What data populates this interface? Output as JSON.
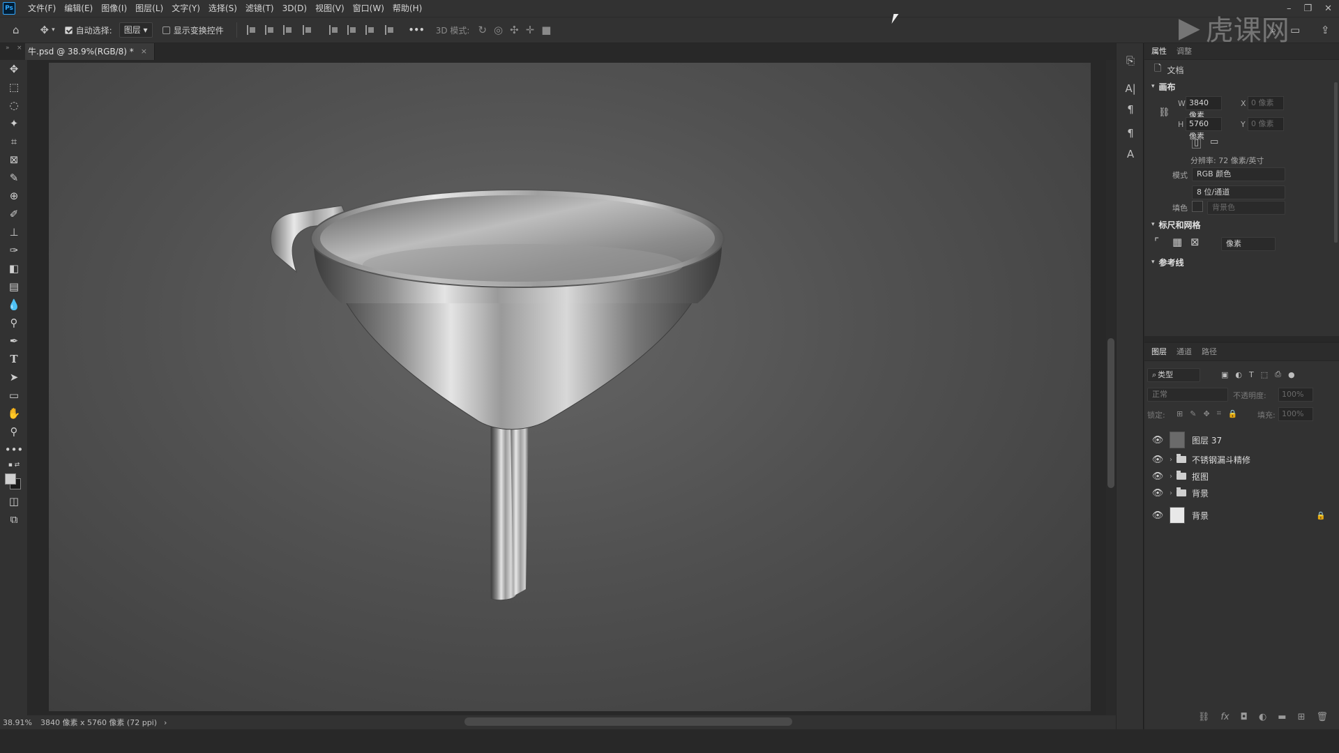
{
  "app": {
    "logo": "Ps"
  },
  "menu": [
    "文件(F)",
    "编辑(E)",
    "图像(I)",
    "图层(L)",
    "文字(Y)",
    "选择(S)",
    "滤镜(T)",
    "3D(D)",
    "视图(V)",
    "窗口(W)",
    "帮助(H)"
  ],
  "options": {
    "auto_select_label": "自动选择:",
    "auto_select_value": "图层",
    "show_transform_label": "显示变换控件",
    "mode_3d_label": "3D 模式:",
    "more": "•••"
  },
  "document": {
    "tab_title": "牛.psd @ 38.9%(RGB/8) *",
    "close": "×"
  },
  "status": {
    "zoom": "38.91%",
    "info": "3840 像素 x 5760 像素 (72 ppi)",
    "arrow": "›"
  },
  "properties": {
    "tabs": [
      "属性",
      "调整"
    ],
    "doc_label": "文档",
    "canvas_section": "画布",
    "w_label": "W",
    "w_value": "3840 像素",
    "h_label": "H",
    "h_value": "5760 像素",
    "x_label": "X",
    "x_value": "0 像素",
    "y_label": "Y",
    "y_value": "0 像素",
    "resolution": "分辨率: 72 像素/英寸",
    "mode_label": "模式",
    "mode_value": "RGB 颜色",
    "depth_value": "8 位/通道",
    "fill_label": "填色",
    "fill_value": "背景色",
    "rulers_section": "标尺和网格",
    "units_value": "像素",
    "cut_section": "参考线"
  },
  "layers": {
    "tabs": [
      "图层",
      "通道",
      "路径"
    ],
    "filter_label": "类型",
    "blend_mode": "正常",
    "opacity_label": "不透明度:",
    "opacity_value": "100%",
    "lock_label": "锁定:",
    "fill_label": "填充:",
    "fill_value": "100%",
    "items": [
      {
        "name": "图层 37",
        "type": "layer"
      },
      {
        "name": "不锈钢漏斗精修",
        "type": "group"
      },
      {
        "name": "抠图",
        "type": "group"
      },
      {
        "name": "背景",
        "type": "group"
      },
      {
        "name": "背景",
        "type": "layer-locked"
      }
    ]
  },
  "watermark": "虎课网",
  "colors": {
    "accent": "#31a8ff",
    "panel": "#323232",
    "canvas": "#555555"
  }
}
